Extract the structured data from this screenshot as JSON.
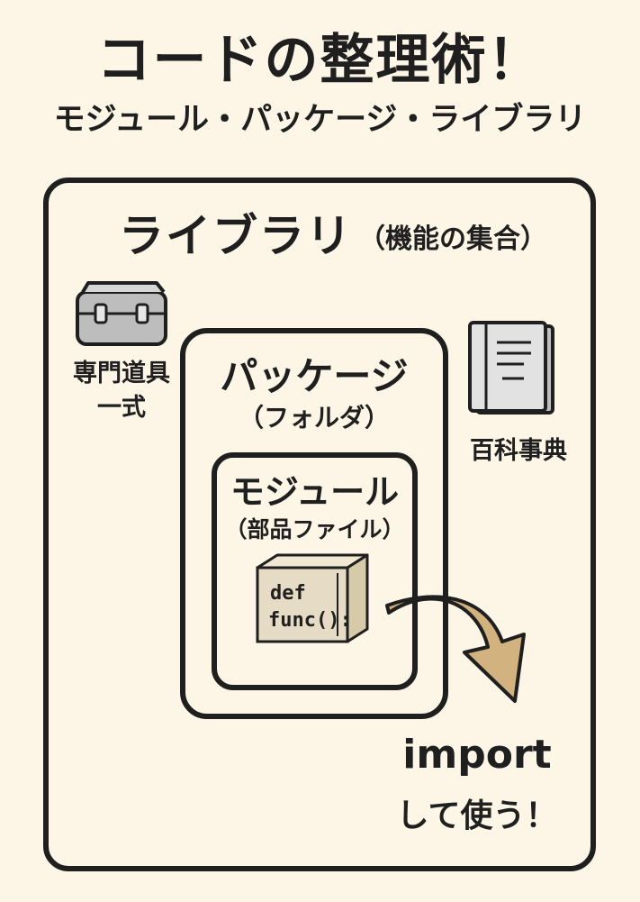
{
  "title": "コードの整理術！",
  "subtitle": "モジュール・パッケージ・ライブラリ",
  "library": {
    "label": "ライブラリ",
    "note": "（機能の集合）"
  },
  "package": {
    "label": "パッケージ",
    "note": "（フォルダ）"
  },
  "module": {
    "label": "モジュール",
    "note": "（部品ファイル）"
  },
  "toolbox": {
    "label_line1": "専門道具",
    "label_line2": "一式",
    "icon": "toolbox-icon"
  },
  "encyclopedia": {
    "label": "百科事典",
    "icon": "book-icon"
  },
  "code_box": {
    "line1": "def",
    "line2": "func():",
    "icon": "cardboard-box-icon"
  },
  "import_note": {
    "keyword": "import",
    "text": "して使う！"
  },
  "colors": {
    "background": "#fdf6e6",
    "ink": "#1f1f1f",
    "box_fill": "#e6dcc6",
    "arrow_fill": "#d2b27f",
    "gray_fill": "#c9c9c9"
  }
}
